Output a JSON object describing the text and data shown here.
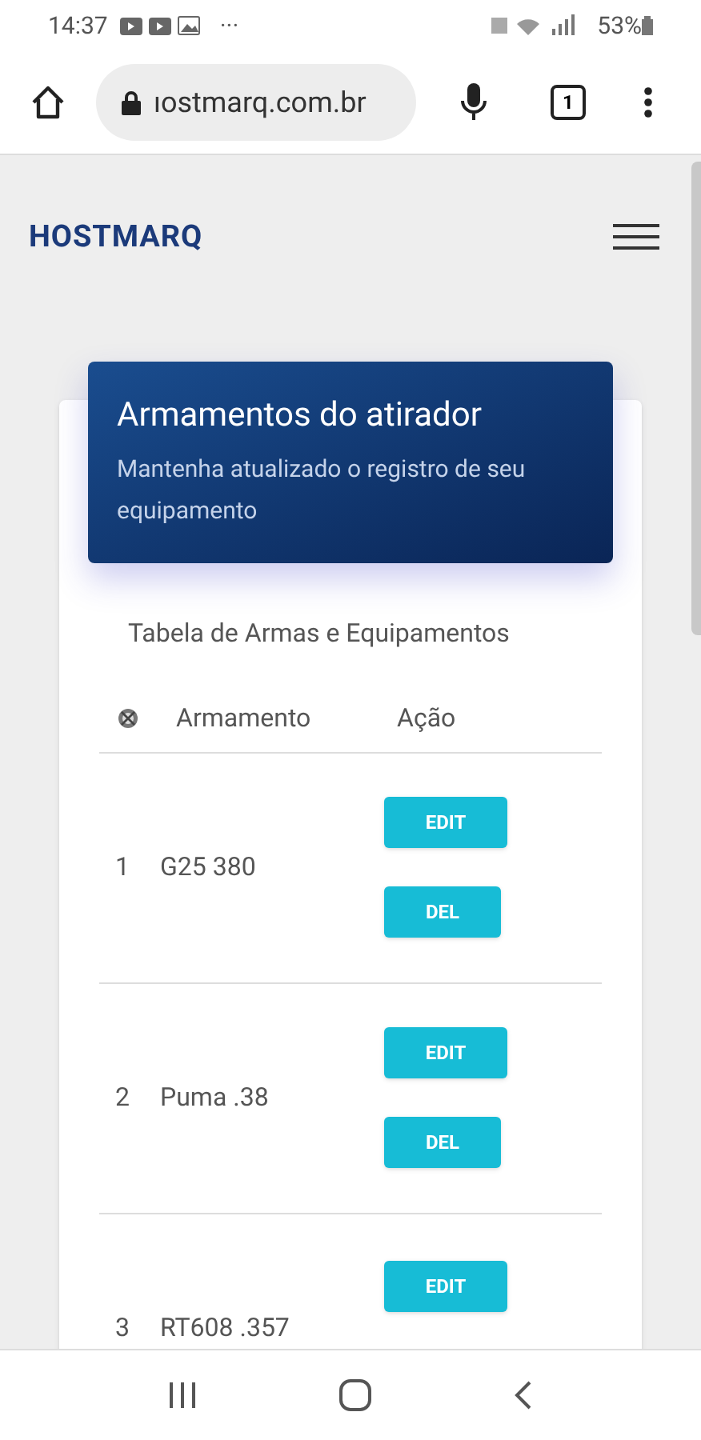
{
  "status_bar": {
    "time": "14:37",
    "more": "···",
    "battery": "53%"
  },
  "browser": {
    "url": "ıostmarq.com.br",
    "tab_count": "1"
  },
  "site": {
    "logo": "HOSTMARQ"
  },
  "card": {
    "title": "Armamentos do atirador",
    "subtitle": "Mantenha atualizado o registro de seu equipamento",
    "table_caption": "Tabela de Armas e Equipamentos",
    "columns": [
      "Armamento",
      "Ação"
    ],
    "rows": [
      {
        "index": "1",
        "name": "G25 380",
        "actions": [
          "EDIT",
          "DEL"
        ]
      },
      {
        "index": "2",
        "name": "Puma .38",
        "actions": [
          "EDIT",
          "DEL"
        ]
      },
      {
        "index": "3",
        "name": "RT608 .357",
        "actions": [
          "EDIT"
        ]
      }
    ]
  }
}
